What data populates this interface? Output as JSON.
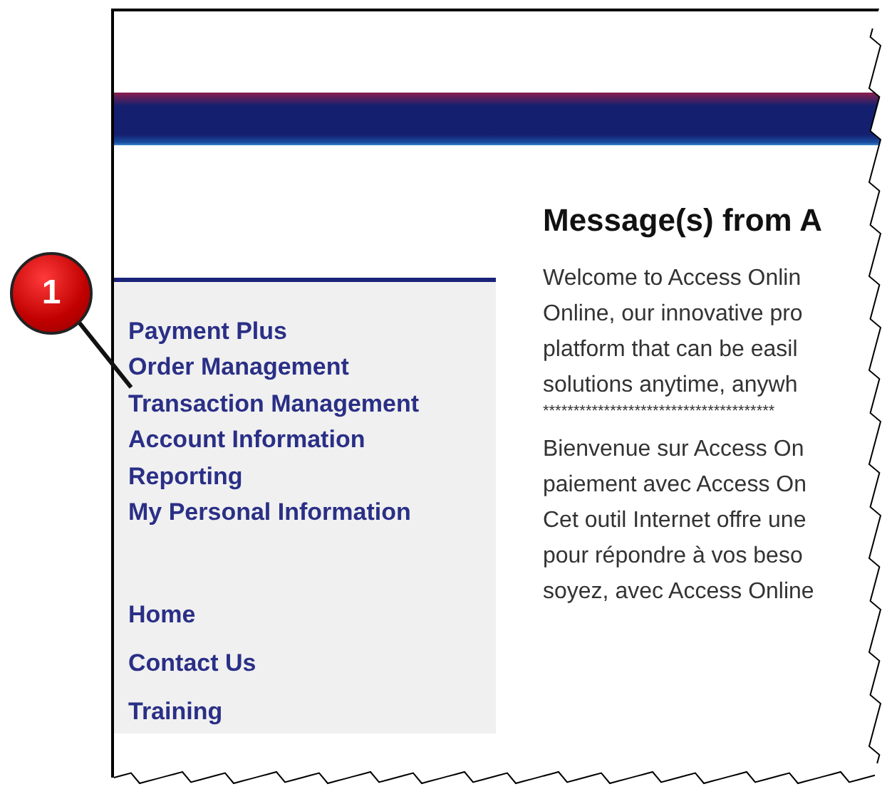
{
  "callout": {
    "number": "1"
  },
  "heading": "Message(s) from A",
  "sidebar": {
    "main_links": [
      "Payment Plus",
      "Order Management",
      "Transaction Management",
      "Account Information",
      "Reporting",
      "My Personal Information"
    ],
    "footer_links": [
      "Home",
      "Contact Us",
      "Training"
    ]
  },
  "messages": [
    [
      "Welcome to Access Onlin",
      "Online, our innovative pro",
      "platform that can be easil",
      "solutions anytime, anywh",
      "**************************************"
    ],
    [
      "Bienvenue sur Access On",
      "paiement avec Access On",
      "Cet outil Internet offre une",
      "pour répondre à vos beso",
      "soyez, avec Access Online"
    ]
  ]
}
